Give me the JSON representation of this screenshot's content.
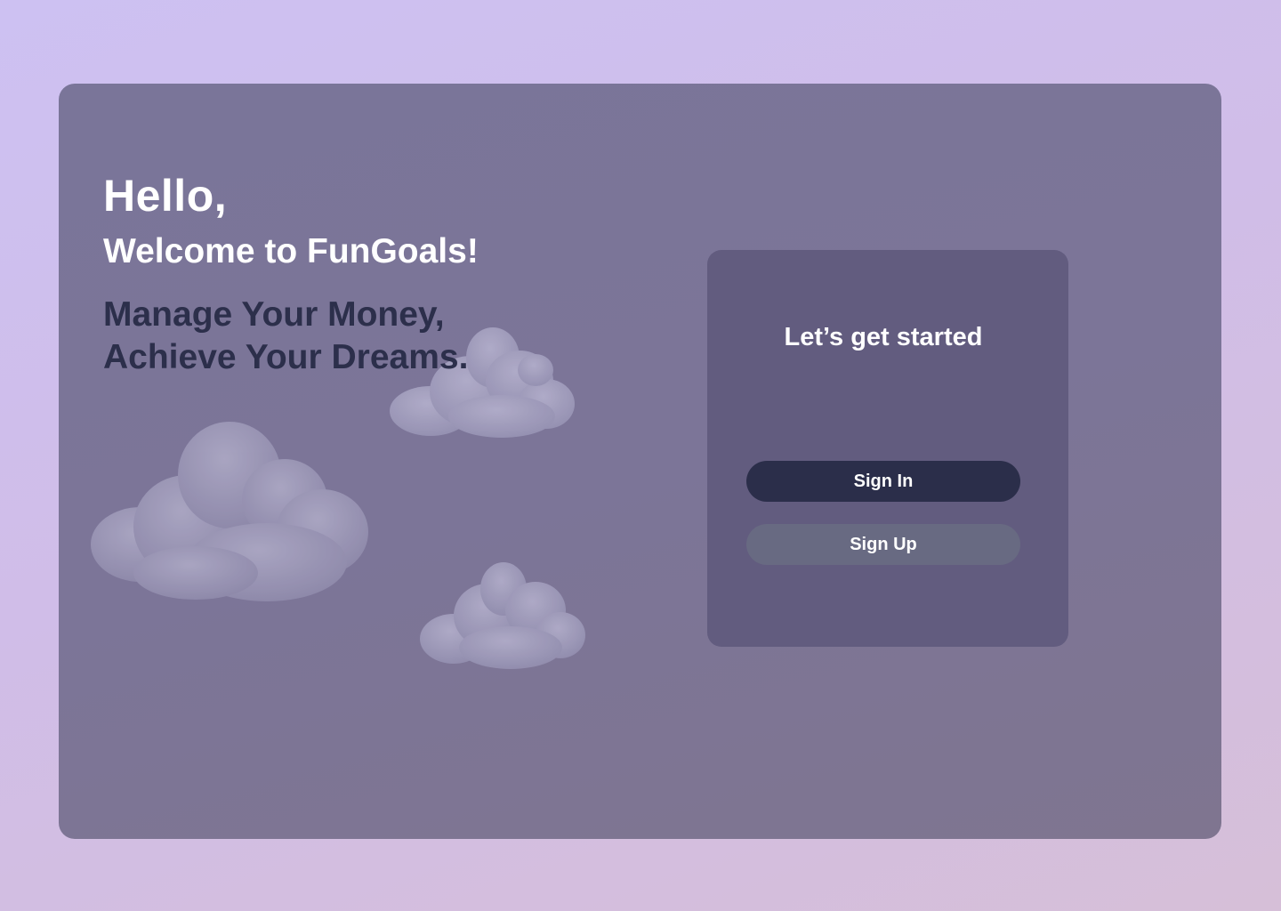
{
  "hero": {
    "greeting": "Hello,",
    "welcome": "Welcome to FunGoals!",
    "tagline_line1": "Manage Your Money,",
    "tagline_line2": "Achieve Your Dreams."
  },
  "auth_card": {
    "title": "Let’s get started",
    "sign_in_label": "Sign In",
    "sign_up_label": "Sign Up"
  },
  "colors": {
    "page_background": "#cdc1f2",
    "panel": "#7a7599",
    "card": "#625c7f",
    "sign_in_button": "#2b2e4a",
    "sign_up_button": "#686a82",
    "tagline_text": "#2c2f4b"
  }
}
